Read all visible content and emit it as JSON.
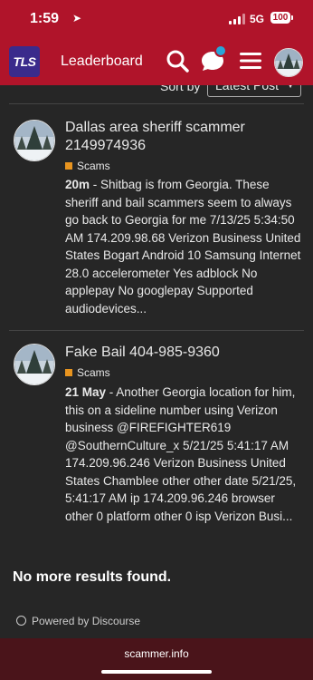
{
  "status_bar": {
    "time": "1:59",
    "network": "5G",
    "battery": "100"
  },
  "header": {
    "logo_text": "TLS",
    "title": "Leaderboard",
    "icons": [
      "search-icon",
      "chat-icon",
      "hamburger-menu-icon",
      "avatar"
    ]
  },
  "sort": {
    "label": "Sort by",
    "selected": "Latest Post"
  },
  "topics": [
    {
      "title": "Dallas area sheriff scammer 2149974936",
      "category": "Scams",
      "category_color": "#e8941f",
      "age": "20m",
      "excerpt": "Shitbag is from Georgia. These sheriff and bail scammers seem to always go back to Georgia for me 7/13/25 5:34:50 AM 174.209.98.68 Verizon Business United States Bogart Android 10 Samsung Internet 28.0 accelerometer Yes adblock No applepay No googlepay Supported audiodevices..."
    },
    {
      "title": "Fake Bail 404-985-9360",
      "category": "Scams",
      "category_color": "#e8941f",
      "age": "21 May",
      "excerpt": "Another Georgia location for him, this on a sideline number using Verizon business @FIREFIGHTER619 @SouthernCulture_x 5/21/25 5:41:17 AM 174.209.96.246 Verizon Business United States Chamblee other other date 5/21/25, 5:41:17 AM ip 174.209.96.246 browser other 0 platform other 0 isp Verizon Busi..."
    }
  ],
  "footer": {
    "no_more": "No more results found.",
    "powered_by": "Powered by Discourse"
  },
  "browser": {
    "url": "scammer.info"
  },
  "colors": {
    "brand": "#b0142a",
    "background": "#262626",
    "notification": "#2aa5d8",
    "url_bar": "#4a141a"
  }
}
